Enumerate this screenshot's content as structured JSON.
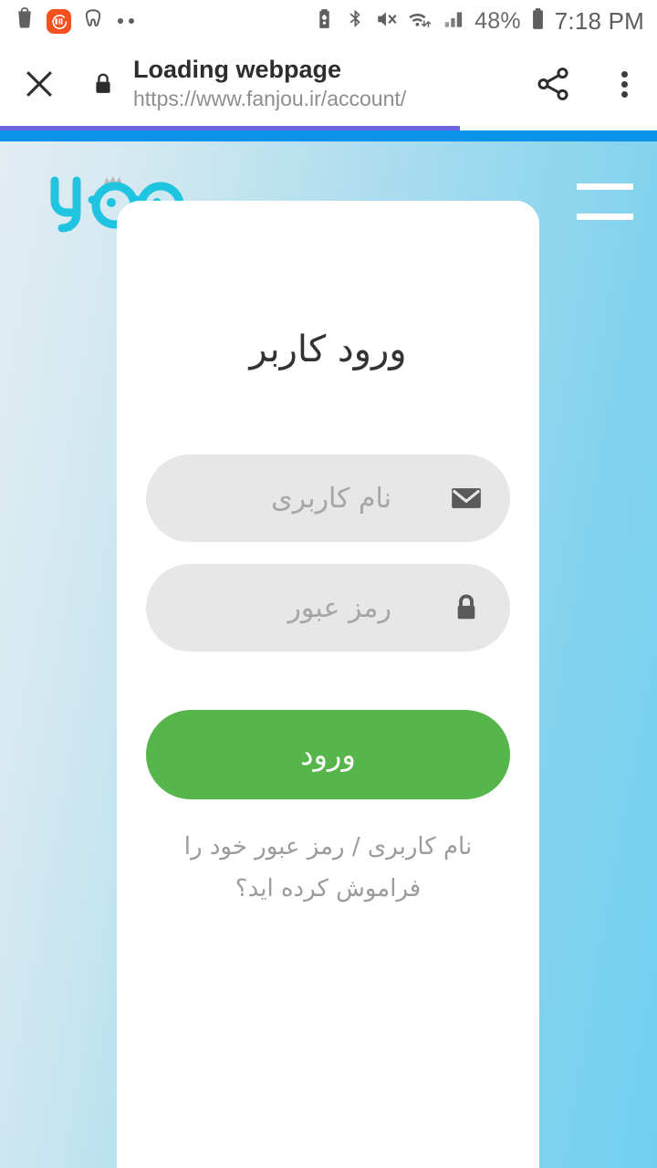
{
  "status_bar": {
    "left_icons": [
      "bucket-icon",
      "mi-app-icon",
      "tooth-icon",
      "more-dots-icon"
    ],
    "right_icons": [
      "battery-saver-icon",
      "bluetooth-icon",
      "mute-icon",
      "wifi-icon",
      "signal-icon"
    ],
    "battery_percent": "48%",
    "time": "7:18 PM"
  },
  "browser": {
    "close_label": "close-icon",
    "lock_label": "lock-icon",
    "title": "Loading webpage",
    "url": "https://www.fanjou.ir/account/",
    "share_label": "share-icon",
    "menu_label": "more-vert-icon",
    "progress_percent": 70,
    "progress_color": "#6e63e0",
    "accent_bar_color": "#0a93e8"
  },
  "site": {
    "logo_text": "فنجو",
    "logo_color": "#1fc4e0",
    "menu_label": "hamburger-menu",
    "background_from": "#e2edf2",
    "background_to": "#72cfef"
  },
  "login_card": {
    "title": "ورود کاربر",
    "fields": [
      {
        "icon": "envelope-icon",
        "placeholder": "نام کاربری",
        "value": ""
      },
      {
        "icon": "lock-icon",
        "placeholder": "رمز عبور",
        "value": ""
      }
    ],
    "submit_label": "ورود",
    "submit_color": "#56b64b",
    "forgot_text": "نام کاربری / رمز عبور خود را فراموش کرده اید؟"
  }
}
